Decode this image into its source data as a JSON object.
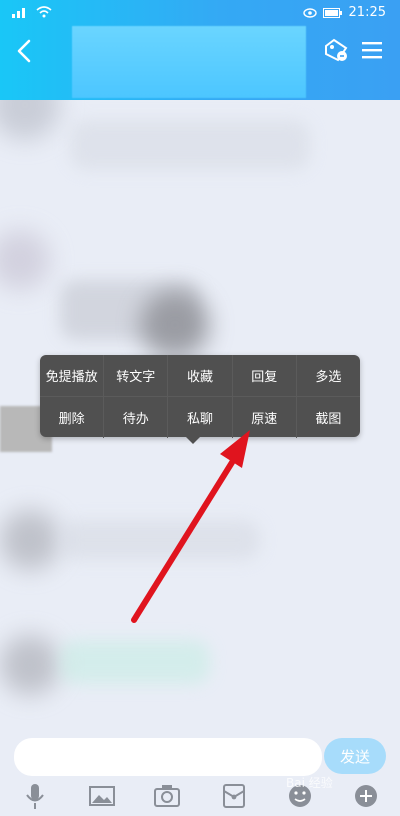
{
  "status": {
    "time": "21:25"
  },
  "context_menu": {
    "row1": [
      "免提播放",
      "转文字",
      "收藏",
      "回复",
      "多选"
    ],
    "row2": [
      "删除",
      "待办",
      "私聊",
      "原速",
      "截图"
    ]
  },
  "composer": {
    "send_label": "发送",
    "input_value": ""
  },
  "watermark": "Bai 经验",
  "colors": {
    "header_start": "#19c7f7",
    "header_end": "#3aa0f3",
    "menu_bg": "#505050",
    "arrow": "#e0141e",
    "send_disabled": "#a7dcfb"
  },
  "icons": {
    "back": "chevron-left-icon",
    "tag": "tag-icon",
    "menu": "hamburger-icon",
    "mic": "microphone-icon",
    "image": "image-icon",
    "camera": "camera-icon",
    "red_packet": "red-packet-icon",
    "emoji": "emoji-icon",
    "plus": "plus-icon"
  }
}
